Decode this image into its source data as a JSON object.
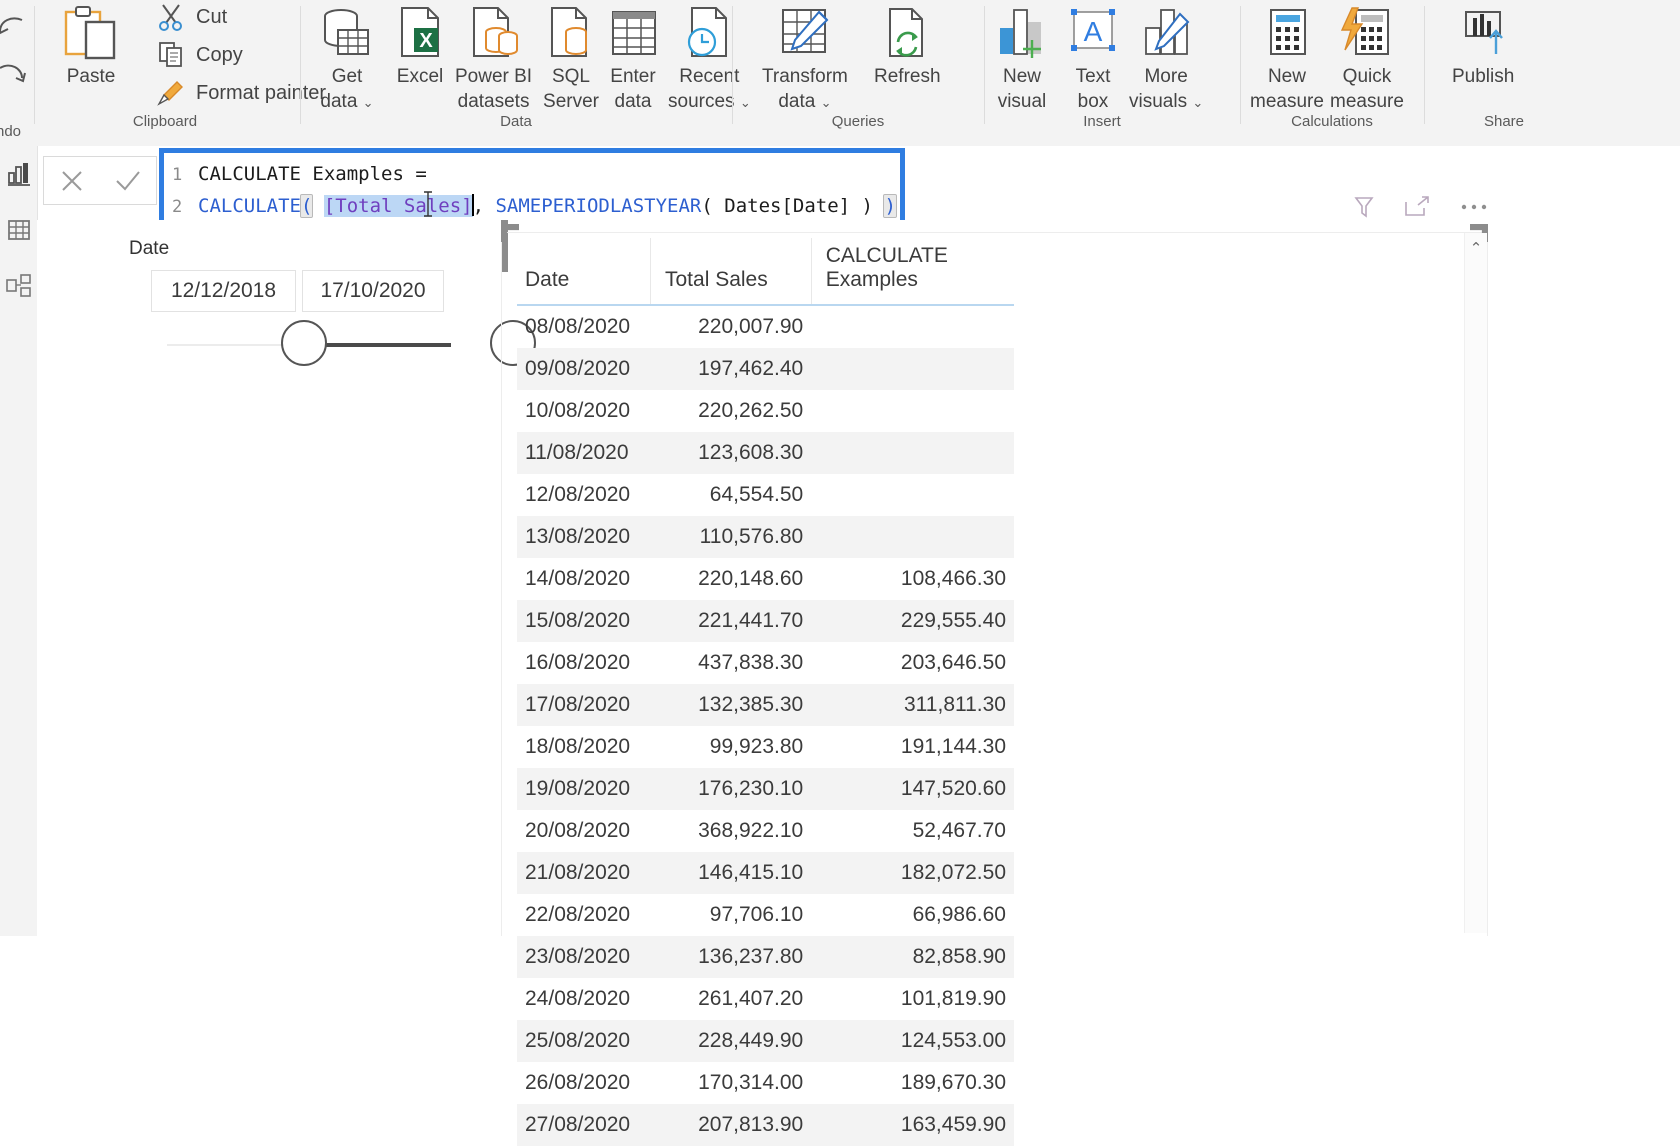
{
  "ribbon": {
    "groups": [
      {
        "name": "Clipboard",
        "label": "Clipboard"
      },
      {
        "name": "Data",
        "label": "Data"
      },
      {
        "name": "Queries",
        "label": "Queries"
      },
      {
        "name": "Insert",
        "label": "Insert"
      },
      {
        "name": "Calculations",
        "label": "Calculations"
      },
      {
        "name": "Share",
        "label": "Share"
      }
    ],
    "undo_label": "ndo",
    "clipboard": {
      "paste": "Paste",
      "cut": "Cut",
      "copy": "Copy",
      "format_painter": "Format painter"
    },
    "data": {
      "get_data": "Get",
      "get_data2": "data",
      "excel": "Excel",
      "powerbi1": "Power BI",
      "powerbi2": "datasets",
      "sql1": "SQL",
      "sql2": "Server",
      "enter1": "Enter",
      "enter2": "data",
      "recent1": "Recent",
      "recent2": "sources"
    },
    "queries": {
      "transform1": "Transform",
      "transform2": "data",
      "refresh": "Refresh"
    },
    "insert": {
      "newvisual1": "New",
      "newvisual2": "visual",
      "textbox1": "Text",
      "textbox2": "box",
      "morevisuals1": "More",
      "morevisuals2": "visuals"
    },
    "calculations": {
      "newmeasure1": "New",
      "newmeasure2": "measure",
      "quickmeasure1": "Quick",
      "quickmeasure2": "measure"
    },
    "share": {
      "publish": "Publish"
    },
    "chevron": "⌄"
  },
  "formula_bar": {
    "cancel_icon": "close-icon",
    "accept_icon": "check-icon",
    "line1_number": "1",
    "line2_number": "2",
    "line1_text": "CALCULATE Examples =",
    "line2": {
      "fn": "CALCULATE",
      "open_paren": "(",
      "space1": " ",
      "selected_ref": "[Total Sales]",
      "comma": ", ",
      "fn2": "SAMEPERIODLASTYEAR",
      "open2": "( ",
      "table_ref": "Dates[Date]",
      "close2": " ) ",
      "close_paren": ")"
    }
  },
  "rail": {
    "items": [
      {
        "name": "report-view",
        "icon": "bar-chart-icon"
      },
      {
        "name": "data-view",
        "icon": "table-icon"
      },
      {
        "name": "model-view",
        "icon": "relationships-icon"
      }
    ]
  },
  "slicer": {
    "title": "Date",
    "start_date": "12/12/2018",
    "end_date": "17/10/2020"
  },
  "visual_tools": {
    "filter": "filter-icon",
    "focus": "focus-mode-icon",
    "more": "more-options-icon"
  },
  "table": {
    "columns": [
      "Date",
      "Total Sales",
      "CALCULATE Examples"
    ],
    "rows": [
      {
        "date": "08/08/2020",
        "total_sales": "220,007.90",
        "calculate_examples": ""
      },
      {
        "date": "09/08/2020",
        "total_sales": "197,462.40",
        "calculate_examples": ""
      },
      {
        "date": "10/08/2020",
        "total_sales": "220,262.50",
        "calculate_examples": ""
      },
      {
        "date": "11/08/2020",
        "total_sales": "123,608.30",
        "calculate_examples": ""
      },
      {
        "date": "12/08/2020",
        "total_sales": "64,554.50",
        "calculate_examples": ""
      },
      {
        "date": "13/08/2020",
        "total_sales": "110,576.80",
        "calculate_examples": ""
      },
      {
        "date": "14/08/2020",
        "total_sales": "220,148.60",
        "calculate_examples": "108,466.30"
      },
      {
        "date": "15/08/2020",
        "total_sales": "221,441.70",
        "calculate_examples": "229,555.40"
      },
      {
        "date": "16/08/2020",
        "total_sales": "437,838.30",
        "calculate_examples": "203,646.50"
      },
      {
        "date": "17/08/2020",
        "total_sales": "132,385.30",
        "calculate_examples": "311,811.30"
      },
      {
        "date": "18/08/2020",
        "total_sales": "99,923.80",
        "calculate_examples": "191,144.30"
      },
      {
        "date": "19/08/2020",
        "total_sales": "176,230.10",
        "calculate_examples": "147,520.60"
      },
      {
        "date": "20/08/2020",
        "total_sales": "368,922.10",
        "calculate_examples": "52,467.70"
      },
      {
        "date": "21/08/2020",
        "total_sales": "146,415.10",
        "calculate_examples": "182,072.50"
      },
      {
        "date": "22/08/2020",
        "total_sales": "97,706.10",
        "calculate_examples": "66,986.60"
      },
      {
        "date": "23/08/2020",
        "total_sales": "136,237.80",
        "calculate_examples": "82,858.90"
      },
      {
        "date": "24/08/2020",
        "total_sales": "261,407.20",
        "calculate_examples": "101,819.90"
      },
      {
        "date": "25/08/2020",
        "total_sales": "228,449.90",
        "calculate_examples": "124,553.00"
      },
      {
        "date": "26/08/2020",
        "total_sales": "170,314.00",
        "calculate_examples": "189,670.30"
      },
      {
        "date": "27/08/2020",
        "total_sales": "207,813.90",
        "calculate_examples": "163,459.90"
      }
    ],
    "scroll_up_glyph": "⌃"
  },
  "colors": {
    "editor_border": "#2f7de1",
    "dax_function": "#2d5fd0",
    "dax_reference": "#6f3fbf",
    "selection": "#bcd7f5",
    "header_underline": "#b9d7f0",
    "row_alt": "#f3f3f3",
    "ribbon_bg": "#f3f3f3"
  }
}
